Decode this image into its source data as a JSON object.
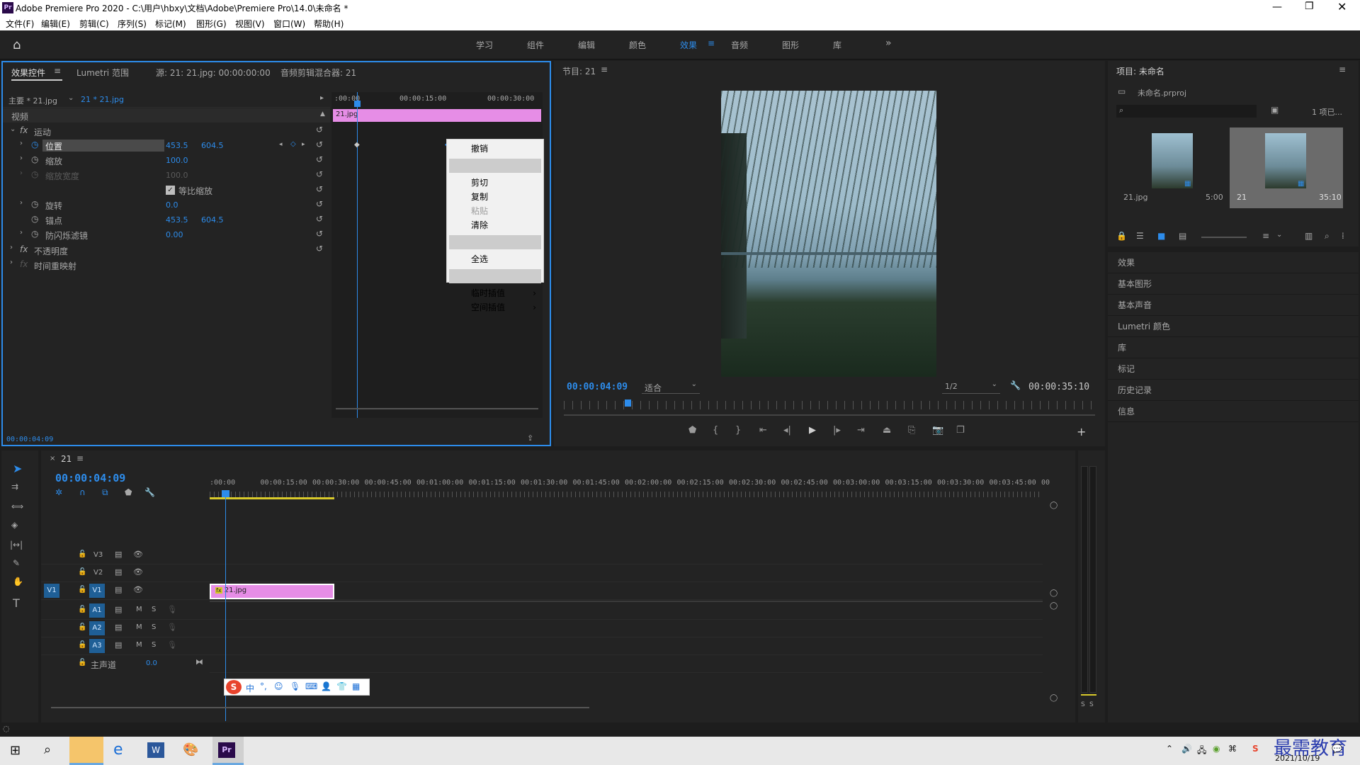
{
  "window": {
    "title": "Adobe Premiere Pro 2020 - C:\\用户\\hbxy\\文档\\Adobe\\Premiere Pro\\14.0\\未命名 *",
    "app_icon": "Pr"
  },
  "menu": [
    "文件(F)",
    "编辑(E)",
    "剪辑(C)",
    "序列(S)",
    "标记(M)",
    "图形(G)",
    "视图(V)",
    "窗口(W)",
    "帮助(H)"
  ],
  "workspaces": [
    "学习",
    "组件",
    "编辑",
    "颜色",
    "效果",
    "音频",
    "图形",
    "库"
  ],
  "active_workspace": "效果",
  "ec": {
    "tabs": [
      "效果控件",
      "Lumetri 范围",
      "源: 21: 21.jpg: 00:00:00:00",
      "音频剪辑混合器: 21"
    ],
    "master": "主要 * 21.jpg",
    "seq": "21 * 21.jpg",
    "tc0": ":00:00",
    "tc15": "00:00:15:00",
    "tc30": "00:00:30:00",
    "clip": "21.jpg",
    "video": "视频",
    "motion": "运动",
    "position": "位置",
    "pos_x": "453.5",
    "pos_y": "604.5",
    "scale": "缩放",
    "scale_v": "100.0",
    "scale_w": "缩放宽度",
    "scale_w_v": "100.0",
    "uniform": "等比缩放",
    "rotation": "旋转",
    "rotation_v": "0.0",
    "anchor": "锚点",
    "anchor_x": "453.5",
    "anchor_y": "604.5",
    "flicker": "防闪烁滤镜",
    "flicker_v": "0.00",
    "opacity": "不透明度",
    "remap": "时间重映射",
    "timecode": "00:00:04:09"
  },
  "context_menu": [
    "撤销",
    "剪切",
    "复制",
    "粘贴",
    "清除",
    "全选",
    "临时插值",
    "空间插值"
  ],
  "program": {
    "title": "节目: 21",
    "timecode": "00:00:04:09",
    "fit": "适合",
    "res": "1/2",
    "duration": "00:00:35:10"
  },
  "project": {
    "title": "项目: 未命名",
    "file": "未命名.prproj",
    "count": "1 项已...",
    "item1": "21.jpg",
    "item1_dur": "5:00",
    "item2": "21",
    "item2_dur": "35:10"
  },
  "right_panels": [
    "效果",
    "基本图形",
    "基本声音",
    "Lumetri 颜色",
    "库",
    "标记",
    "历史记录",
    "信息"
  ],
  "timeline": {
    "tab": "21",
    "timecode": "00:00:04:09",
    "ruler": [
      ":00:00",
      "00:00:15:00",
      "00:00:30:00",
      "00:00:45:00",
      "00:01:00:00",
      "00:01:15:00",
      "00:01:30:00",
      "00:01:45:00",
      "00:02:00:00",
      "00:02:15:00",
      "00:02:30:00",
      "00:02:45:00",
      "00:03:00:00",
      "00:03:15:00",
      "00:03:30:00",
      "00:03:45:00",
      "00"
    ],
    "tracks_v": [
      "V3",
      "V2",
      "V1"
    ],
    "tracks_a": [
      "A1",
      "A2",
      "A3"
    ],
    "master": "主声道",
    "master_v": "0.0",
    "clip": "21.jpg",
    "src_v": "V1"
  },
  "taskbar": {
    "date": "2021/10/19",
    "watermark": "最需教育",
    "pr": "Pr"
  },
  "ime": {
    "label": "中"
  },
  "meter": {
    "labels": [
      "S",
      "S"
    ]
  }
}
